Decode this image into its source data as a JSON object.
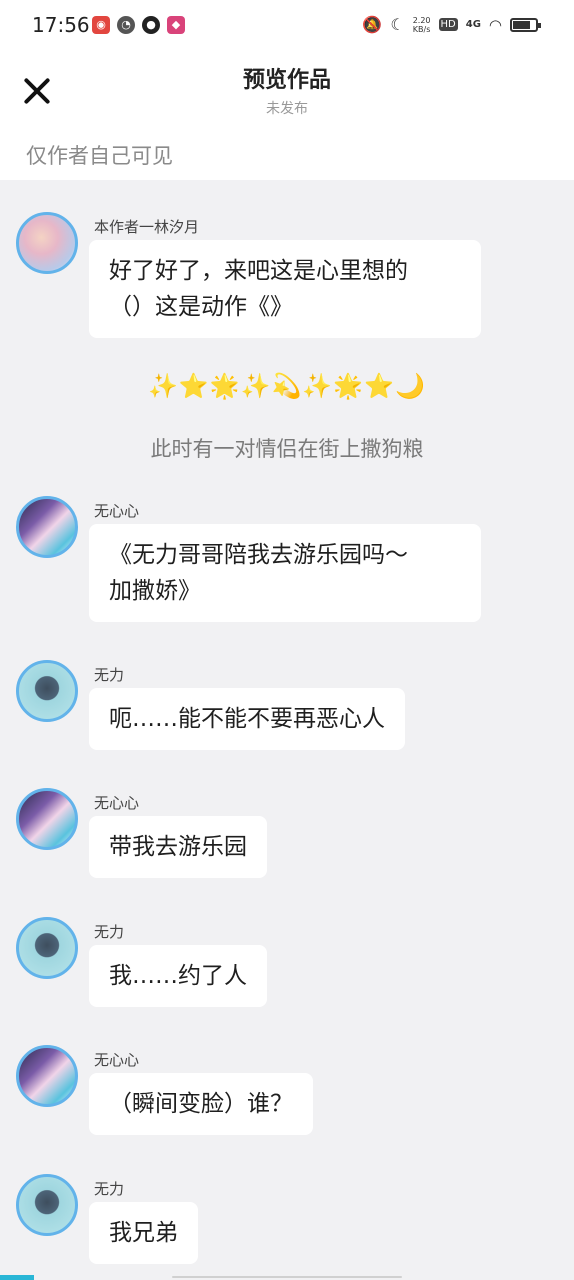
{
  "status_bar": {
    "time": "17:56",
    "net_speed_value": "2.20",
    "net_speed_unit": "KB/s",
    "hd": "HD",
    "network": "4G",
    "battery_level": 0.7
  },
  "header": {
    "title": "预览作品",
    "subtitle": "未发布",
    "visibility_note": "仅作者自己可见"
  },
  "chat": {
    "messages": [
      {
        "sender": "本作者一林汐月",
        "text": "好了好了，来吧这是心里想的\n（）这是动作《》"
      },
      {
        "sender": "无心心",
        "text": "《无力哥哥陪我去游乐园吗～\n加撒娇》"
      },
      {
        "sender": "无力",
        "text": "呃……能不能不要再恶心人"
      },
      {
        "sender": "无心心",
        "text": "带我去游乐园"
      },
      {
        "sender": "无力",
        "text": "我……约了人"
      },
      {
        "sender": "无心心",
        "text": "（瞬间变脸）谁？"
      },
      {
        "sender": "无力",
        "text": "我兄弟"
      }
    ],
    "emoji_line": "✨⭐🌟✨💫✨🌟⭐🌙",
    "narration": "此时有一对情侣在街上撒狗粮"
  }
}
